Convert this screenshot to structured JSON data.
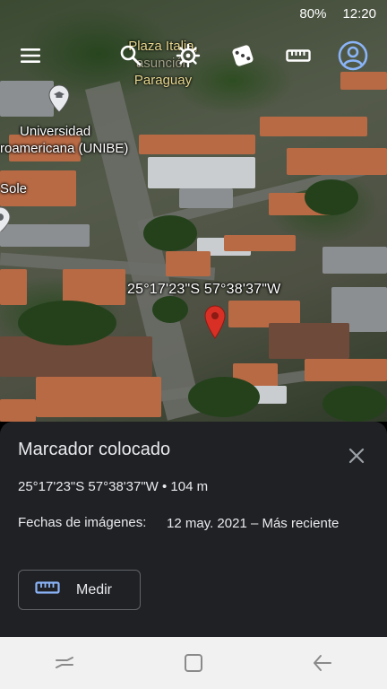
{
  "status_bar": {
    "battery": "80%",
    "time": "12:20"
  },
  "toolbar": {
    "menu_icon": "hamburger-menu-icon",
    "search_icon": "search-icon",
    "voyager_icon": "helm-icon",
    "random_icon": "dice-icon",
    "measure_icon": "ruler-icon",
    "account_icon": "account-circle-icon"
  },
  "map": {
    "place_label": {
      "line1": "Plaza Italia,",
      "line2": "asunción",
      "line3": "Paraguay"
    },
    "poi_university": {
      "line1": "Universidad",
      "line2": "roamericana (UNIBE)"
    },
    "poi_sole": "Sole",
    "marker_coordinates": "25°17'23\"S 57°38'37\"W"
  },
  "sheet": {
    "title": "Marcador colocado",
    "coords": "25°17'23\"S 57°38'37\"W • 104 m",
    "dates_label": "Fechas de imágenes:",
    "dates_value": "12 may. 2021 – Más reciente",
    "measure_label": "Medir"
  },
  "colors": {
    "sheet_bg": "#202124",
    "marker_red": "#d93025",
    "account_blue": "#8ab4f8"
  }
}
